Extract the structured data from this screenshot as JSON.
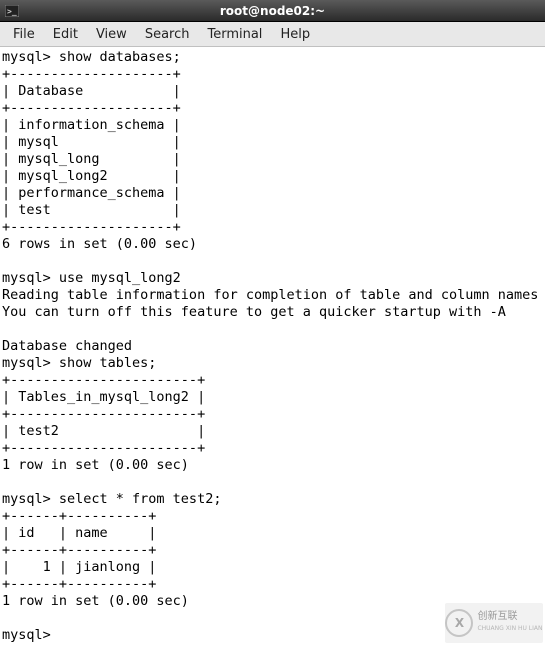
{
  "window": {
    "title": "root@node02:~"
  },
  "menu": {
    "file": "File",
    "edit": "Edit",
    "view": "View",
    "search": "Search",
    "terminal": "Terminal",
    "help": "Help"
  },
  "terminal": {
    "content": "mysql> show databases;\n+--------------------+\n| Database           |\n+--------------------+\n| information_schema |\n| mysql              |\n| mysql_long         |\n| mysql_long2        |\n| performance_schema |\n| test               |\n+--------------------+\n6 rows in set (0.00 sec)\n\nmysql> use mysql_long2\nReading table information for completion of table and column names\nYou can turn off this feature to get a quicker startup with -A\n\nDatabase changed\nmysql> show tables;\n+-----------------------+\n| Tables_in_mysql_long2 |\n+-----------------------+\n| test2                 |\n+-----------------------+\n1 row in set (0.00 sec)\n\nmysql> select * from test2;\n+------+----------+\n| id   | name     |\n+------+----------+\n|    1 | jianlong |\n+------+----------+\n1 row in set (0.00 sec)\n\nmysql> "
  },
  "watermark": {
    "logo_letter": "X",
    "line1": "创新互联",
    "line2": "CHUANG XIN HU LIAN"
  }
}
